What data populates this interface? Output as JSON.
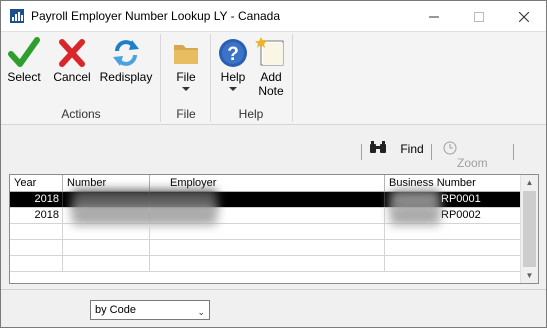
{
  "window": {
    "title": "Payroll Employer Number Lookup LY - Canada",
    "minimize_icon": "minimize-icon",
    "maximize_icon": "maximize-icon",
    "close_icon": "close-icon"
  },
  "ribbon": {
    "groups": [
      {
        "label": "Actions",
        "buttons": [
          {
            "label": "Select",
            "icon": "check-icon"
          },
          {
            "label": "Cancel",
            "icon": "x-icon"
          },
          {
            "label": "Redisplay",
            "icon": "refresh-icon"
          }
        ]
      },
      {
        "label": "File",
        "buttons": [
          {
            "label": "File",
            "icon": "folder-icon"
          }
        ]
      },
      {
        "label": "Help",
        "buttons": [
          {
            "label": "Help",
            "icon": "help-icon"
          },
          {
            "label_line1": "Add",
            "label_line2": "Note",
            "icon": "note-icon"
          }
        ]
      }
    ]
  },
  "toolbar": {
    "find_label": "Find",
    "zoom_label": "Zoom"
  },
  "grid": {
    "columns": [
      "Year",
      "Number",
      "Employer",
      "Business Number"
    ],
    "rows": [
      {
        "year": "2018",
        "number": "",
        "employer": "",
        "business_number": "RP0001"
      },
      {
        "year": "2018",
        "number": "",
        "employer": "",
        "business_number": "RP0002"
      }
    ]
  },
  "sort_select": {
    "value": "by Code"
  },
  "colors": {
    "select_green": "#2e9e2e",
    "cancel_red": "#d9262b",
    "refresh_blue": "#1f7fc9",
    "help_blue": "#2a5fb0",
    "selected_row": "#000000"
  }
}
